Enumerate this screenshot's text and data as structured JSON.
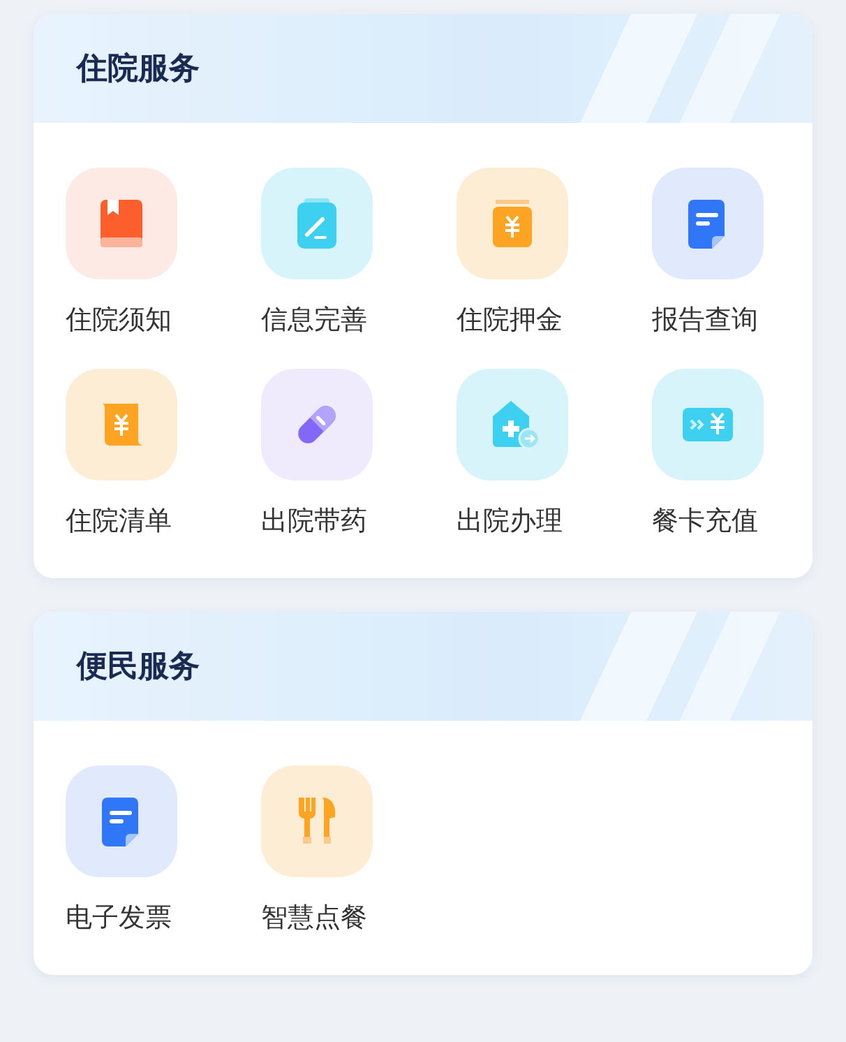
{
  "sections": [
    {
      "title": "住院服务",
      "items": [
        {
          "label": "住院须知",
          "kind": "book"
        },
        {
          "label": "信息完善",
          "kind": "clipboard"
        },
        {
          "label": "住院押金",
          "kind": "deposit"
        },
        {
          "label": "报告查询",
          "kind": "document"
        },
        {
          "label": "住院清单",
          "kind": "scroll"
        },
        {
          "label": "出院带药",
          "kind": "pill"
        },
        {
          "label": "出院办理",
          "kind": "discharge"
        },
        {
          "label": "餐卡充值",
          "kind": "card"
        }
      ]
    },
    {
      "title": "便民服务",
      "items": [
        {
          "label": "电子发票",
          "kind": "document"
        },
        {
          "label": "智慧点餐",
          "kind": "cutlery"
        }
      ]
    }
  ]
}
